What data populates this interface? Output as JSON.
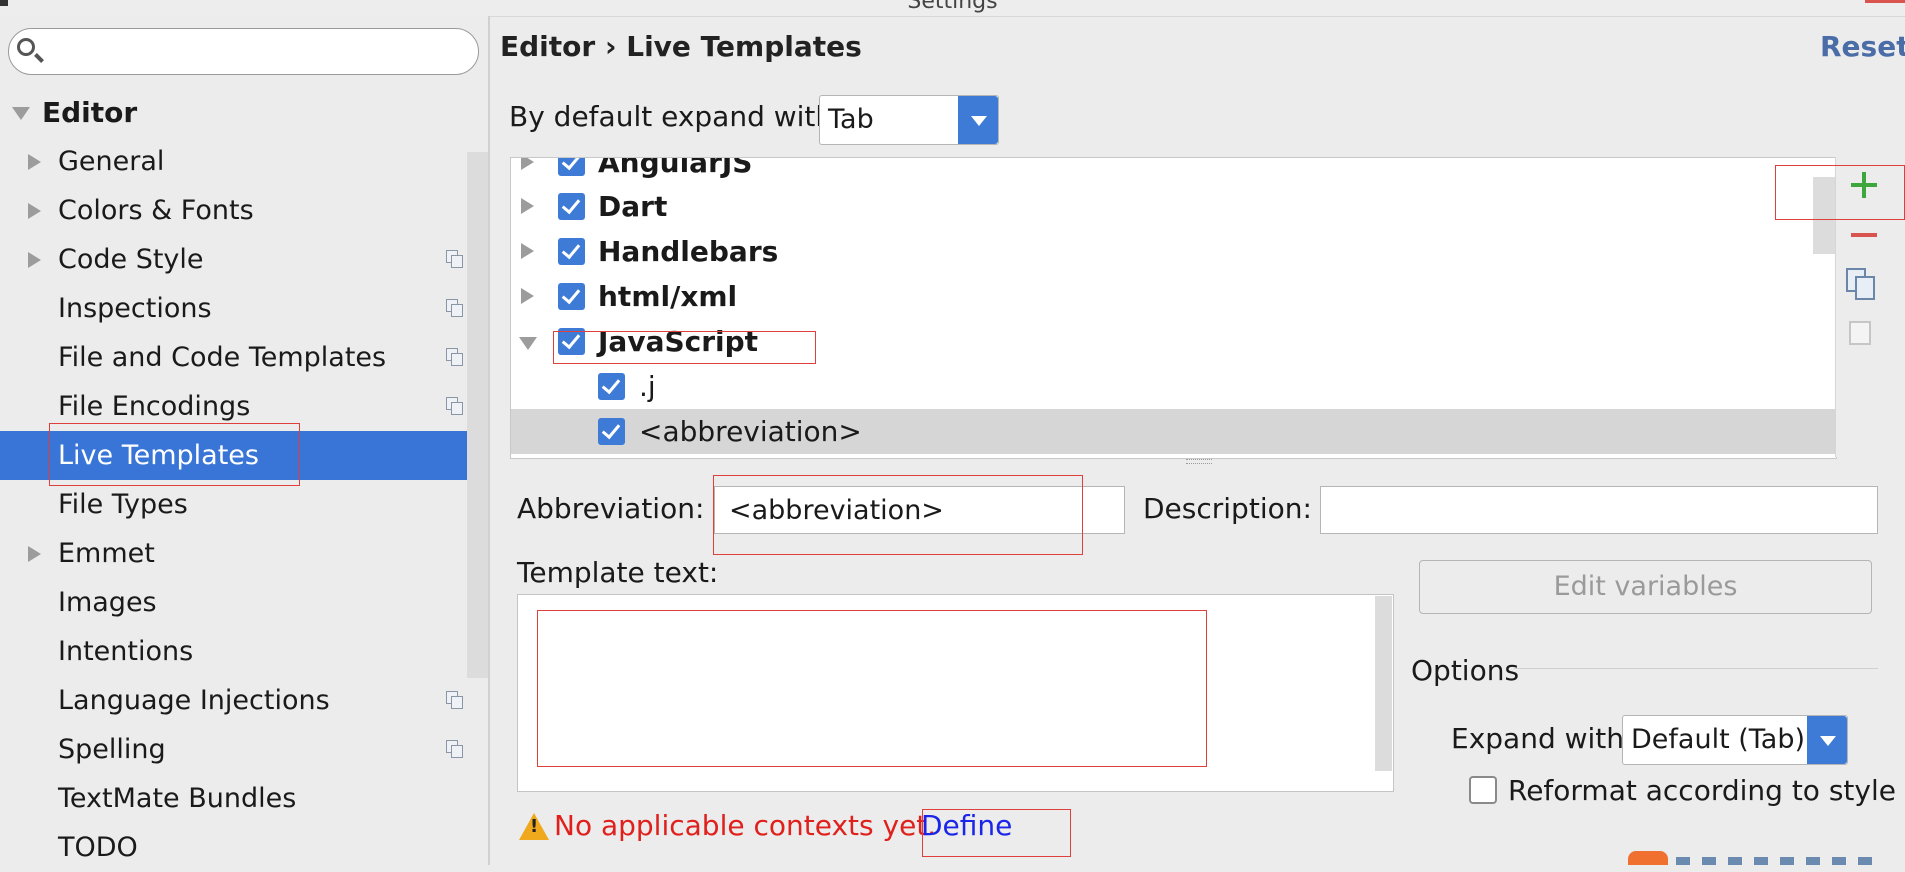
{
  "window": {
    "title": "Settings"
  },
  "search": {
    "placeholder": "",
    "value": ""
  },
  "sidebar": {
    "root": "Editor",
    "items": [
      {
        "label": "General"
      },
      {
        "label": "Colors & Fonts"
      },
      {
        "label": "Code Style"
      },
      {
        "label": "Inspections"
      },
      {
        "label": "File and Code Templates"
      },
      {
        "label": "File Encodings"
      },
      {
        "label": "Live Templates"
      },
      {
        "label": "File Types"
      },
      {
        "label": "Emmet"
      },
      {
        "label": "Images"
      },
      {
        "label": "Intentions"
      },
      {
        "label": "Language Injections"
      },
      {
        "label": "Spelling"
      },
      {
        "label": "TextMate Bundles"
      },
      {
        "label": "TODO"
      }
    ]
  },
  "header": {
    "breadcrumb": "Editor › Live Templates",
    "reset": "Reset"
  },
  "expand": {
    "label": "By default expand with",
    "value": "Tab"
  },
  "template_groups": [
    {
      "label": "AngularJS",
      "checked": true
    },
    {
      "label": "Dart",
      "checked": true
    },
    {
      "label": "Handlebars",
      "checked": true
    },
    {
      "label": "html/xml",
      "checked": true
    },
    {
      "label": "JavaScript",
      "checked": true
    },
    {
      "label": ".j",
      "checked": true
    },
    {
      "label": "<abbreviation>",
      "checked": true
    }
  ],
  "form": {
    "abbreviation_label": "Abbreviation:",
    "abbreviation_value": "<abbreviation>",
    "description_label": "Description:",
    "description_value": "",
    "template_text_label": "Template text:",
    "template_text_value": "",
    "edit_variables": "Edit variables",
    "options_label": "Options",
    "expand_with_label": "Expand with",
    "expand_with_value": "Default (Tab)",
    "reformat_label": "Reformat according to style",
    "reformat_checked": false
  },
  "warning": {
    "text": "No applicable contexts yet.",
    "link": "Define"
  },
  "colors": {
    "accent": "#3875d7",
    "warning_text": "#e0201c",
    "link": "#1a25e8",
    "annotation_box": "#e0403c"
  }
}
